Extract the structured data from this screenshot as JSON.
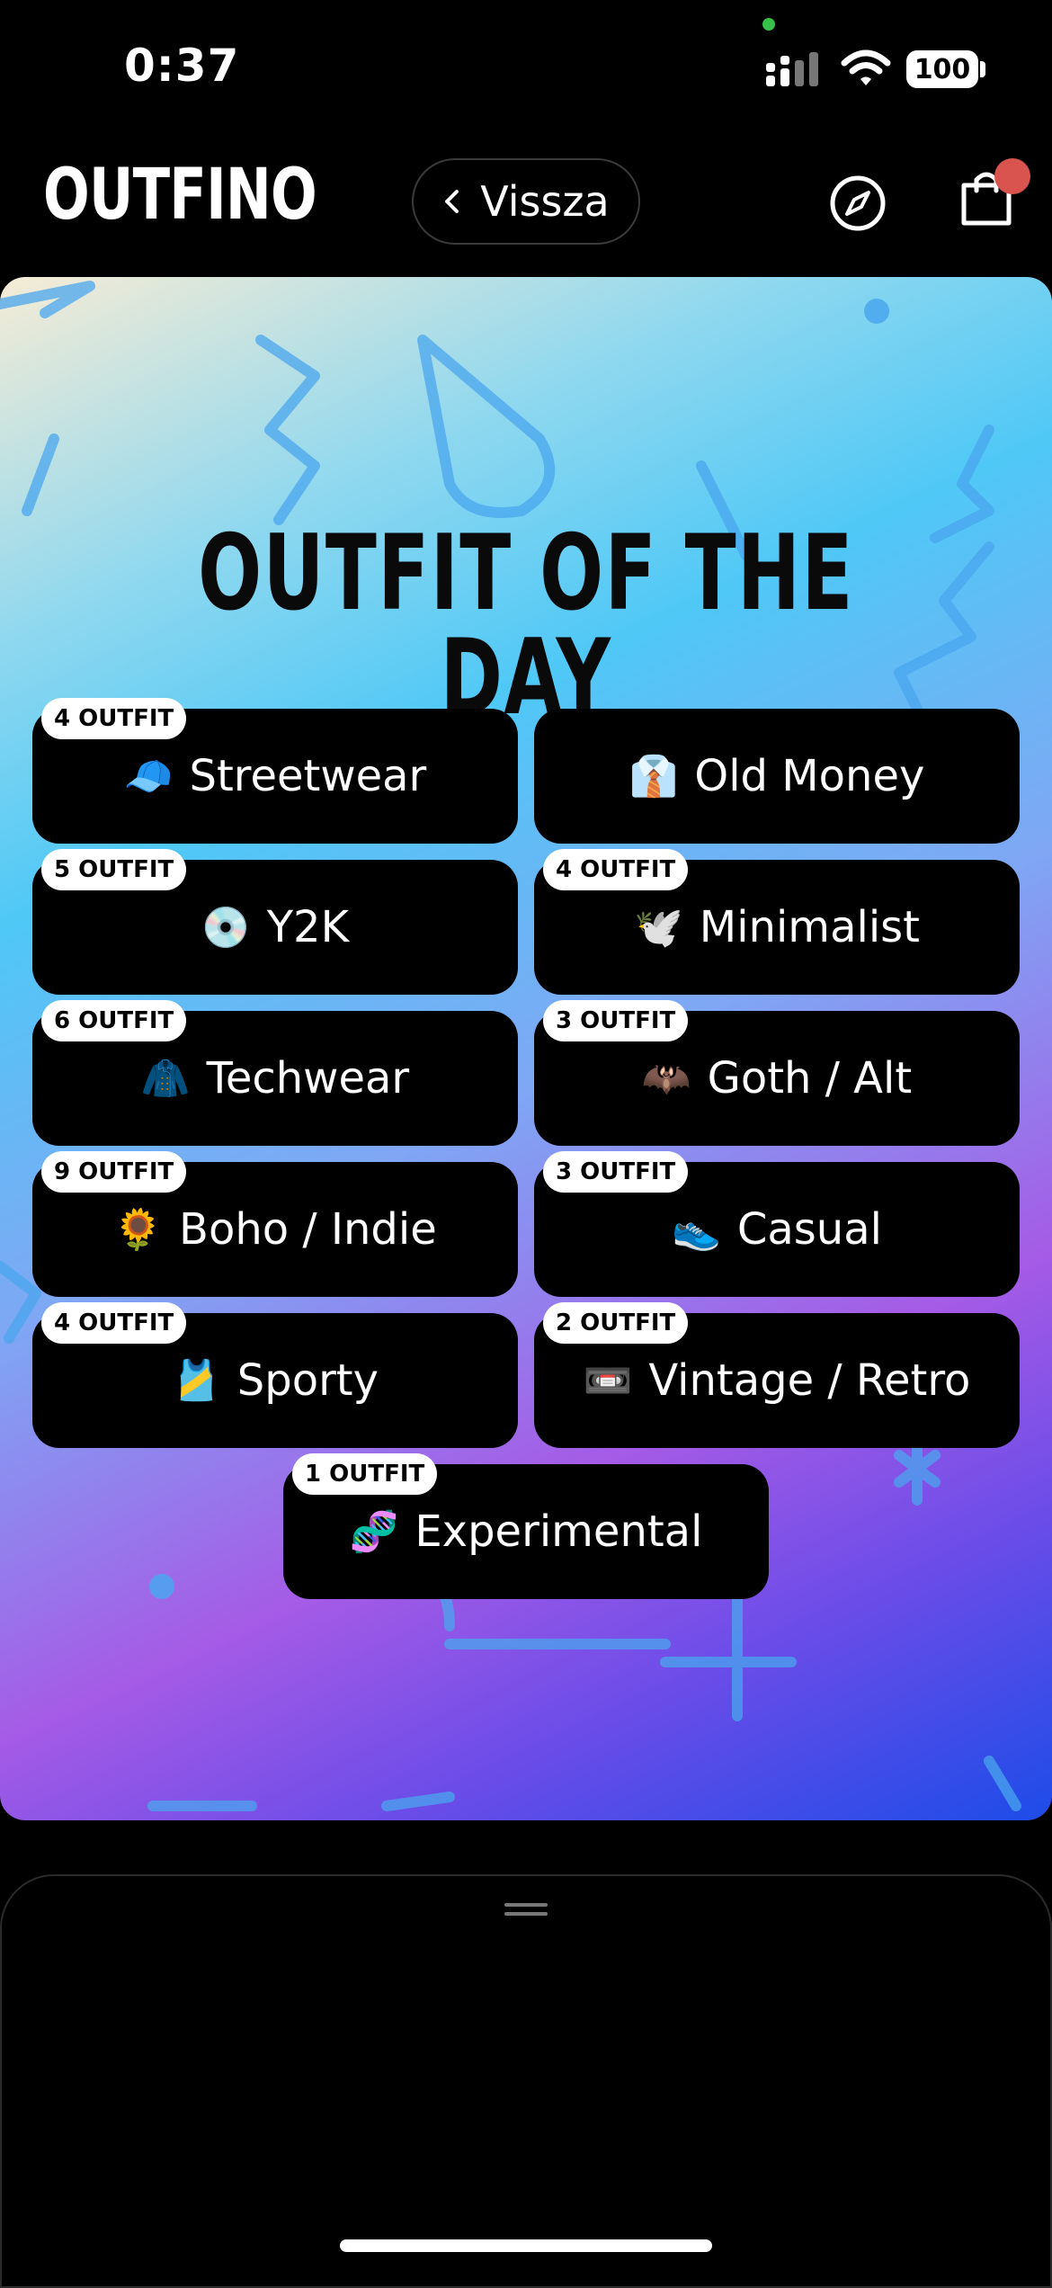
{
  "status": {
    "time": "0:37",
    "battery": "100"
  },
  "header": {
    "logo": "OUTFINO",
    "back_label": "Vissza"
  },
  "hero": {
    "title": "OUTFIT OF THE DAY"
  },
  "categories": [
    {
      "label": "Streetwear",
      "emoji": "🧢",
      "badge": "4 OUTFIT"
    },
    {
      "label": "Old Money",
      "emoji": "👔",
      "badge": ""
    },
    {
      "label": "Y2K",
      "emoji": "💿",
      "badge": "5 OUTFIT"
    },
    {
      "label": "Minimalist",
      "emoji": "🕊️",
      "badge": "4 OUTFIT"
    },
    {
      "label": "Techwear",
      "emoji": "🧥",
      "badge": "6 OUTFIT"
    },
    {
      "label": "Goth / Alt",
      "emoji": "🦇",
      "badge": "3 OUTFIT"
    },
    {
      "label": "Boho / Indie",
      "emoji": "🌻",
      "badge": "9 OUTFIT"
    },
    {
      "label": "Casual",
      "emoji": "👟",
      "badge": "3 OUTFIT"
    },
    {
      "label": "Sporty",
      "emoji": "🎽",
      "badge": "4 OUTFIT"
    },
    {
      "label": "Vintage / Retro",
      "emoji": "📼",
      "badge": "2 OUTFIT"
    },
    {
      "label": "Experimental",
      "emoji": "🧬",
      "badge": "1 OUTFIT"
    }
  ],
  "icons": {
    "back": "chevron-left-icon",
    "compass": "compass-icon",
    "cart": "shopping-bag-icon"
  },
  "colors": {
    "cart_dot": "#d9544f",
    "camera_dot": "#36c24a"
  }
}
